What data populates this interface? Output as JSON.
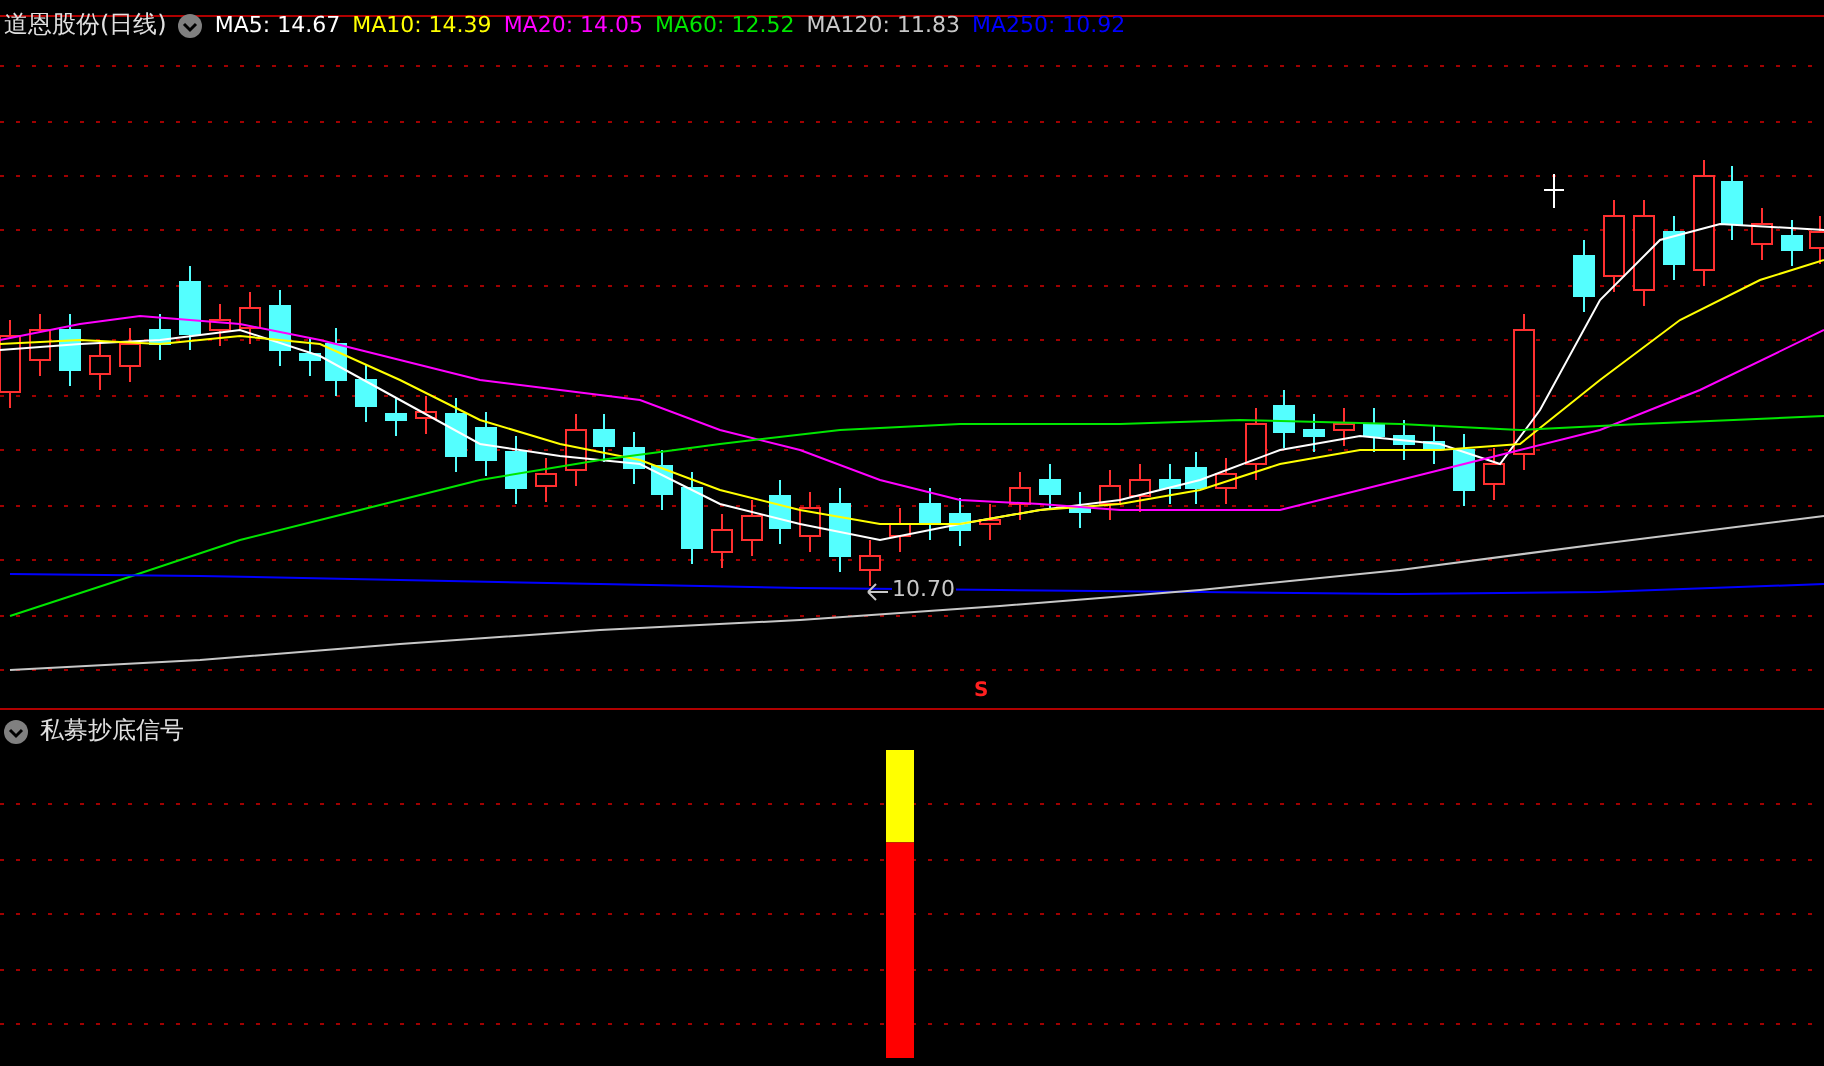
{
  "main_panel": {
    "title": "道恩股份(日线)",
    "legend": [
      {
        "label": "MA5: 14.67",
        "color": "#ffffff"
      },
      {
        "label": "MA10: 14.39",
        "color": "#ffff00"
      },
      {
        "label": "MA20: 14.05",
        "color": "#ff00ff"
      },
      {
        "label": "MA60: 12.52",
        "color": "#00e600"
      },
      {
        "label": "MA120: 11.83",
        "color": "#c8c8c8"
      },
      {
        "label": "MA250: 10.92",
        "color": "#0000ff"
      }
    ],
    "low_marker": "10.70",
    "signal_marker": "S"
  },
  "indicator_panel": {
    "title": "私募抄底信号"
  }
}
